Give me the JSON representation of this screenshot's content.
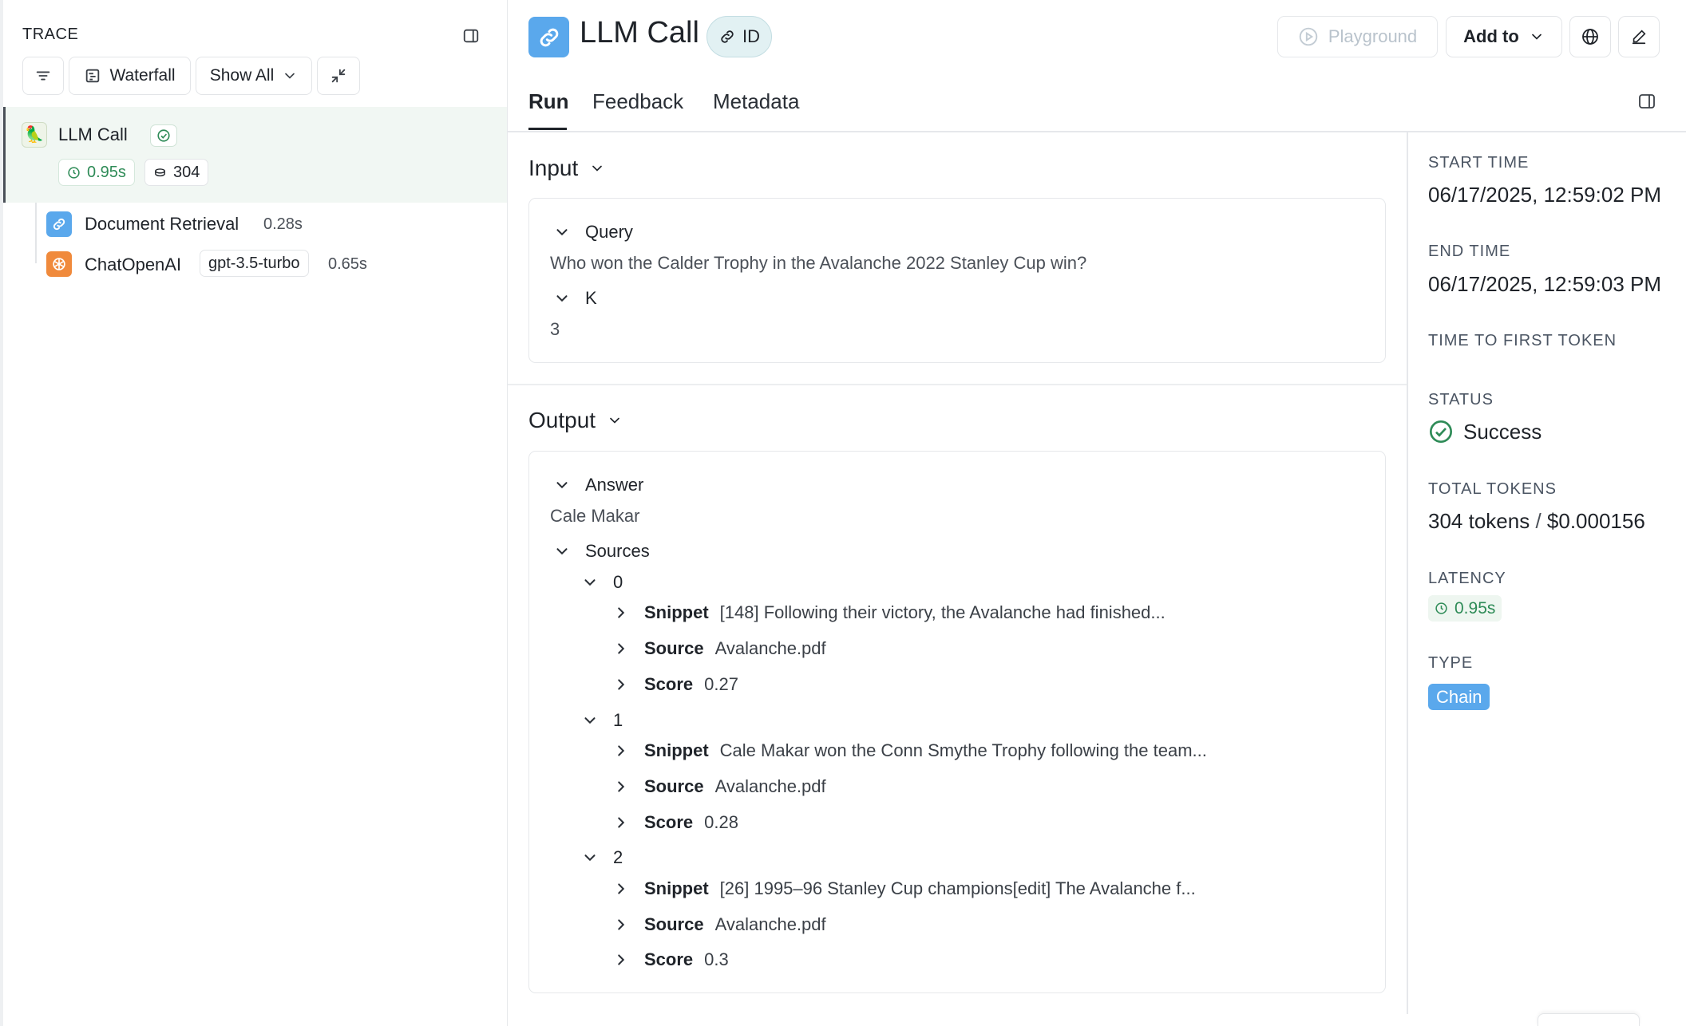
{
  "trace": {
    "label": "TRACE",
    "toolbar": {
      "waterfall_label": "Waterfall",
      "show_all_label": "Show All"
    },
    "nodes": [
      {
        "name": "LLM Call",
        "duration": "0.95s",
        "tokens": "304",
        "status": "success",
        "icon": "parrot-icon"
      },
      {
        "name": "Document Retrieval",
        "duration": "0.28s",
        "icon": "link-icon"
      },
      {
        "name": "ChatOpenAI",
        "model": "gpt-3.5-turbo",
        "duration": "0.65s",
        "icon": "openai-icon"
      }
    ]
  },
  "header": {
    "title": "LLM Call",
    "id_label": "ID",
    "playground_label": "Playground",
    "add_to_label": "Add to"
  },
  "tabs": [
    {
      "label": "Run",
      "active": true
    },
    {
      "label": "Feedback",
      "active": false
    },
    {
      "label": "Metadata",
      "active": false
    }
  ],
  "input": {
    "title": "Input",
    "fields": [
      {
        "key": "Query",
        "value": "Who won the Calder Trophy in the Avalanche 2022 Stanley Cup win?"
      },
      {
        "key": "K",
        "value": "3"
      }
    ]
  },
  "output": {
    "title": "Output",
    "answer_key": "Answer",
    "answer_value": "Cale Makar",
    "sources_key": "Sources",
    "sources": [
      {
        "index": "0",
        "snippet": "[148] Following their victory, the Avalanche had finished...",
        "source": "Avalanche.pdf",
        "score": "0.27"
      },
      {
        "index": "1",
        "snippet": "Cale Makar won the Conn Smythe Trophy following the team...",
        "source": "Avalanche.pdf",
        "score": "0.28"
      },
      {
        "index": "2",
        "snippet": "[26] 1995–96 Stanley Cup champions[edit] The Avalanche f...",
        "source": "Avalanche.pdf",
        "score": "0.3"
      }
    ],
    "labels": {
      "snippet": "Snippet",
      "source": "Source",
      "score": "Score"
    }
  },
  "meta": {
    "start_time_label": "START TIME",
    "start_time": "06/17/2025, 12:59:02 PM",
    "end_time_label": "END TIME",
    "end_time": "06/17/2025, 12:59:03 PM",
    "ttft_label": "TIME TO FIRST TOKEN",
    "status_label": "STATUS",
    "status": "Success",
    "total_tokens_label": "TOTAL TOKENS",
    "total_tokens": "304 tokens",
    "total_cost": "$0.000156",
    "latency_label": "LATENCY",
    "latency": "0.95s",
    "type_label": "TYPE",
    "type": "Chain"
  },
  "colors": {
    "accent_blue": "#5aa8ec",
    "success_green": "#2e8b57",
    "openai_orange": "#f08a3c",
    "selected_bg": "#f1f7f3"
  }
}
